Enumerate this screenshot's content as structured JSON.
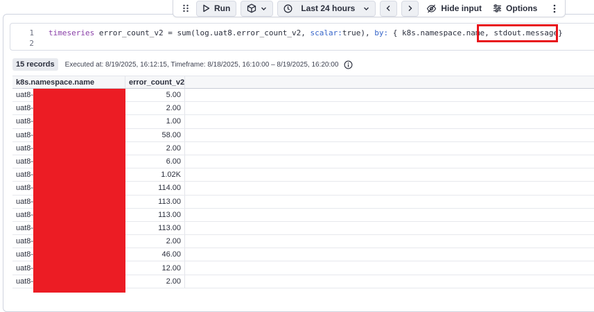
{
  "toolbar": {
    "run_label": "Run",
    "timeframe_label": "Last 24 hours",
    "hide_input_label": "Hide input",
    "options_label": "Options"
  },
  "editor": {
    "line_numbers": [
      "1",
      "2"
    ],
    "code": {
      "keyword": "timeseries",
      "part1": " error_count_v2 = sum(log.uat8.error_count_v2, ",
      "scalar_param": "scalar:",
      "part2": "true), ",
      "by_param": "by:",
      "part3": " { k8s.namespace.name, stdout.message}"
    }
  },
  "meta": {
    "records": "15 records",
    "executed": "Executed at: 8/19/2025, 16:12:15, Timeframe: 8/18/2025, 16:10:00 – 8/19/2025, 16:20:00"
  },
  "table": {
    "columns": [
      "k8s.namespace.name",
      "error_count_v2"
    ],
    "rows": [
      {
        "ns": "uat8-",
        "count": "5.00"
      },
      {
        "ns": "uat8-",
        "count": "2.00"
      },
      {
        "ns": "uat8-",
        "count": "1.00"
      },
      {
        "ns": "uat8-",
        "count": "58.00"
      },
      {
        "ns": "uat8-",
        "count": "2.00"
      },
      {
        "ns": "uat8-",
        "count": "6.00"
      },
      {
        "ns": "uat8-",
        "count": "1.02K"
      },
      {
        "ns": "uat8-",
        "count": "114.00"
      },
      {
        "ns": "uat8-",
        "count": "113.00"
      },
      {
        "ns": "uat8-",
        "count": "113.00"
      },
      {
        "ns": "uat8-",
        "count": "113.00"
      },
      {
        "ns": "uat8-",
        "count": "2.00"
      },
      {
        "ns": "uat8-",
        "count": "46.00"
      },
      {
        "ns": "uat8-",
        "count": "12.00"
      },
      {
        "ns": "uat8-",
        "count": "2.00"
      }
    ]
  },
  "colors": {
    "highlight": "#e8141b",
    "redaction": "#ec1c24"
  },
  "icons": [
    "drag-handle-icon",
    "play-icon",
    "cube-icon",
    "chevron-down-icon",
    "clock-icon",
    "chevron-left-icon",
    "chevron-right-icon",
    "eye-off-icon",
    "sliders-icon",
    "more-vertical-icon",
    "info-icon"
  ]
}
